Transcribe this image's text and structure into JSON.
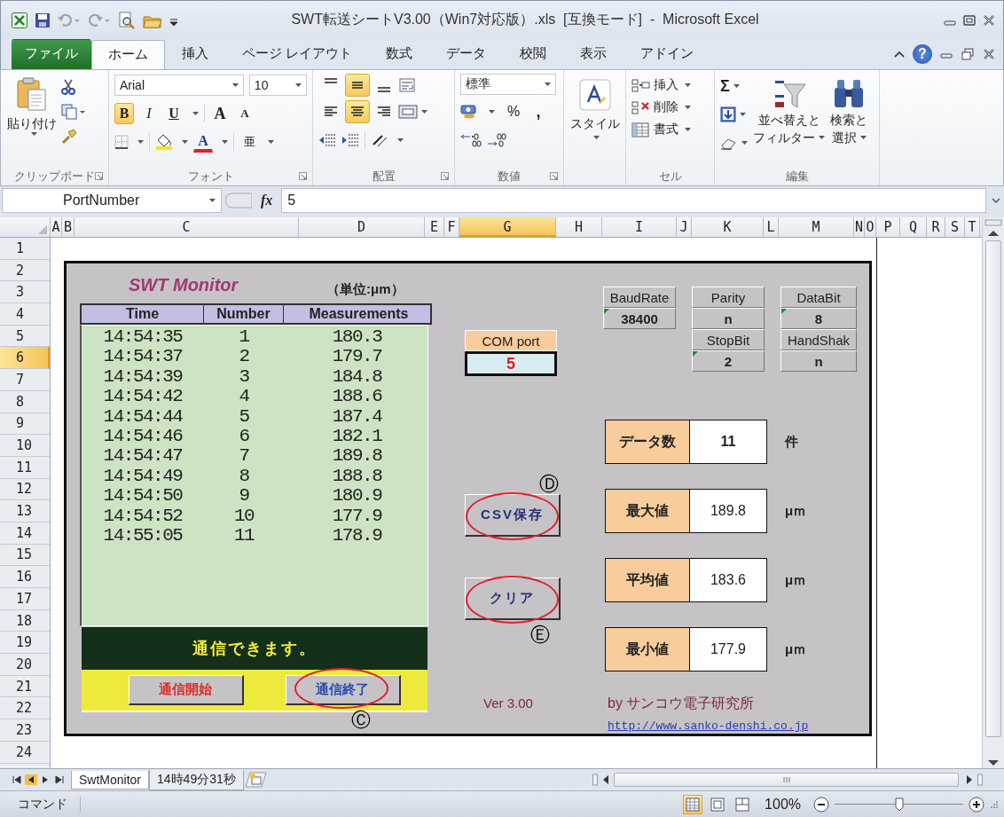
{
  "title_bar": {
    "title": "SWT転送シートV3.00（Win7対応版）.xls  [互換モード]  -  Microsoft Excel"
  },
  "ribbon_tabs": [
    {
      "label": "ファイル",
      "kind": "file",
      "selected": false
    },
    {
      "label": "ホーム",
      "kind": "tab",
      "selected": true
    },
    {
      "label": "挿入",
      "kind": "tab",
      "selected": false
    },
    {
      "label": "ページ レイアウト",
      "kind": "tab",
      "selected": false
    },
    {
      "label": "数式",
      "kind": "tab",
      "selected": false
    },
    {
      "label": "データ",
      "kind": "tab",
      "selected": false
    },
    {
      "label": "校閲",
      "kind": "tab",
      "selected": false
    },
    {
      "label": "表示",
      "kind": "tab",
      "selected": false
    },
    {
      "label": "アドイン",
      "kind": "tab",
      "selected": false
    }
  ],
  "help": "?",
  "ribbon": {
    "clipboard": {
      "label": "クリップボード",
      "paste": "貼り付け"
    },
    "font": {
      "label": "フォント",
      "font_name": "Arial",
      "font_size": "10",
      "styles": [
        {
          "label": "B",
          "kind": "bold",
          "selected": true
        },
        {
          "label": "I",
          "kind": "italic",
          "selected": false
        },
        {
          "label": "U",
          "kind": "underline",
          "selected": false
        }
      ],
      "grow": "A",
      "shrink": "A",
      "font_color": "A",
      "phonetic": "亜"
    },
    "alignment": {
      "label": "配置",
      "buttons": [
        {
          "kind": "top",
          "selected": false
        },
        {
          "kind": "middle",
          "selected": true
        },
        {
          "kind": "bottom",
          "selected": false
        },
        {
          "kind": "left",
          "selected": false
        },
        {
          "kind": "center",
          "selected": true
        },
        {
          "kind": "right",
          "selected": false
        }
      ]
    },
    "number": {
      "label": "数値",
      "format": "標準",
      "percent": "%",
      "comma": ","
    },
    "styles": {
      "label": "スタイル"
    },
    "cells": {
      "label": "セル",
      "items": [
        {
          "label": "挿入",
          "kind": "insert"
        },
        {
          "label": "削除",
          "kind": "delete"
        },
        {
          "label": "書式",
          "kind": "format"
        }
      ]
    },
    "editing": {
      "label": "編集",
      "sum": "Σ",
      "sort": "並べ替えと",
      "sort2": "フィルター",
      "find": "検索と",
      "find2": "選択"
    }
  },
  "formula_bar": {
    "name_box": "PortNumber",
    "fx": "fx",
    "value": "5"
  },
  "columns": [
    {
      "label": "A",
      "selected": false
    },
    {
      "label": "B",
      "selected": false
    },
    {
      "label": "C",
      "selected": false
    },
    {
      "label": "D",
      "selected": false
    },
    {
      "label": "E",
      "selected": false
    },
    {
      "label": "F",
      "selected": false
    },
    {
      "label": "G",
      "selected": true
    },
    {
      "label": "H",
      "selected": false
    },
    {
      "label": "I",
      "selected": false
    },
    {
      "label": "J",
      "selected": false
    },
    {
      "label": "K",
      "selected": false
    },
    {
      "label": "L",
      "selected": false
    },
    {
      "label": "M",
      "selected": false
    },
    {
      "label": "N",
      "selected": false
    },
    {
      "label": "O",
      "selected": false
    },
    {
      "label": "P",
      "selected": false
    },
    {
      "label": "Q",
      "selected": false
    },
    {
      "label": "R",
      "selected": false
    },
    {
      "label": "S",
      "selected": false
    },
    {
      "label": "T",
      "selected": false
    }
  ],
  "rows": [
    {
      "label": "1",
      "selected": false
    },
    {
      "label": "2",
      "selected": false
    },
    {
      "label": "3",
      "selected": false
    },
    {
      "label": "4",
      "selected": false
    },
    {
      "label": "5",
      "selected": false
    },
    {
      "label": "6",
      "selected": true
    },
    {
      "label": "7",
      "selected": false
    },
    {
      "label": "8",
      "selected": false
    },
    {
      "label": "9",
      "selected": false
    },
    {
      "label": "10",
      "selected": false
    },
    {
      "label": "11",
      "selected": false
    },
    {
      "label": "12",
      "selected": false
    },
    {
      "label": "13",
      "selected": false
    },
    {
      "label": "14",
      "selected": false
    },
    {
      "label": "15",
      "selected": false
    },
    {
      "label": "16",
      "selected": false
    },
    {
      "label": "17",
      "selected": false
    },
    {
      "label": "18",
      "selected": false
    },
    {
      "label": "19",
      "selected": false
    },
    {
      "label": "20",
      "selected": false
    },
    {
      "label": "21",
      "selected": false
    },
    {
      "label": "22",
      "selected": false
    },
    {
      "label": "23",
      "selected": false
    },
    {
      "label": "24",
      "selected": false
    }
  ],
  "monitor": {
    "title": "SWT Monitor",
    "unit": "（単位:μm）",
    "columns": [
      "Time",
      "Number",
      "Measurements"
    ],
    "rows": [
      [
        "14:54:35",
        "1",
        "180.3"
      ],
      [
        "14:54:37",
        "2",
        "179.7"
      ],
      [
        "14:54:39",
        "3",
        "184.8"
      ],
      [
        "14:54:42",
        "4",
        "188.6"
      ],
      [
        "14:54:44",
        "5",
        "187.4"
      ],
      [
        "14:54:46",
        "6",
        "182.1"
      ],
      [
        "14:54:47",
        "7",
        "189.8"
      ],
      [
        "14:54:49",
        "8",
        "188.8"
      ],
      [
        "14:54:50",
        "9",
        "180.9"
      ],
      [
        "14:54:52",
        "10",
        "177.9"
      ],
      [
        "14:55:05",
        "11",
        "178.9"
      ]
    ],
    "status": "通信できます。",
    "comm_buttons": [
      {
        "label": "通信開始",
        "kind": "start",
        "circled": false
      },
      {
        "label": "通信終了",
        "kind": "stop",
        "circled": true,
        "marker": "Ⓒ"
      }
    ],
    "com_port": {
      "label": "COM port",
      "value": "5"
    },
    "serial": [
      {
        "label": "BaudRate",
        "value": "38400",
        "flag": true
      },
      {
        "label": "Parity",
        "value": "n",
        "flag": false
      },
      {
        "label": "DataBit",
        "value": "8",
        "flag": true
      },
      {
        "label": "StopBit",
        "value": "2",
        "flag": true
      },
      {
        "label": "HandShak",
        "value": "n",
        "flag": false
      }
    ],
    "actions": [
      {
        "label": "CSV保存",
        "circled": true,
        "marker": "Ⓓ"
      },
      {
        "label": "クリア",
        "circled": true,
        "marker": "Ⓔ"
      }
    ],
    "stats": [
      {
        "label": "データ数",
        "value": "11",
        "unit": "件"
      },
      {
        "label": "最大値",
        "value": "189.8",
        "unit": "μｍ"
      },
      {
        "label": "平均値",
        "value": "183.6",
        "unit": "μｍ"
      },
      {
        "label": "最小値",
        "value": "177.9",
        "unit": "μｍ"
      }
    ],
    "version": "Ver 3.00",
    "author": "by サンコウ電子研究所",
    "link": "http://www.sanko-denshi.co.jp"
  },
  "sheet_tabs": [
    {
      "label": "SwtMonitor",
      "selected": true
    },
    {
      "label": "14時49分31秒",
      "selected": false
    }
  ],
  "status_bar": {
    "mode": "コマンド",
    "views": [
      {
        "kind": "normal",
        "selected": true
      },
      {
        "kind": "page_layout",
        "selected": false
      },
      {
        "kind": "page_break",
        "selected": false
      }
    ],
    "zoom": "100%",
    "zoom_slider": {
      "level": 0.5
    }
  }
}
